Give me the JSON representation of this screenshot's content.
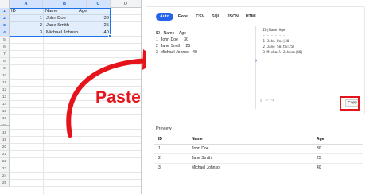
{
  "spreadsheet": {
    "columns": [
      "A",
      "B",
      "C",
      "D"
    ],
    "selected_columns": [
      "A",
      "B",
      "C"
    ],
    "row_numbers": [
      "1",
      "2",
      "3",
      "4",
      "5",
      "6",
      "7",
      "8",
      "9",
      "10",
      "11",
      "12",
      "13",
      "14",
      "15",
      "16",
      "17",
      "18",
      "19",
      "20",
      "21",
      "22",
      "23",
      "24",
      "25"
    ],
    "selected_rows": [
      "1",
      "2",
      "3",
      "4"
    ],
    "cells": {
      "a1": "ID",
      "b1": "Name",
      "c1": "Age",
      "a2": "1",
      "b2": "John Doe",
      "c2": "30",
      "a3": "2",
      "b3": "Jane Smith",
      "c3": "25",
      "a4": "3",
      "b4": "Michael Johnso",
      "c4": "40"
    }
  },
  "overlay": {
    "paste_label": "Paste",
    "accent_color": "#e5141b"
  },
  "converter": {
    "tabs": [
      "Auto",
      "Excel",
      "CSV",
      "SQL",
      "JSON",
      "HTML"
    ],
    "active_tab": "Auto",
    "input_lines": [
      "ID   Name    Age",
      "1  John Doe     30",
      "2  Jane Smith    25",
      "3  Michael Johnso   40"
    ],
    "output_lines": [
      "|ID|Name|Age|",
      "|---|---|---|",
      "|1|John Doe|30|",
      "|2|Jane Smith|25|",
      "|3|Michael Johnso|40|"
    ],
    "copy_label": "Copy",
    "tool_icons": [
      "format-icon",
      "undo-icon",
      "redo-icon"
    ]
  },
  "preview": {
    "title": "Preview",
    "headers": [
      "ID",
      "Name",
      "Age"
    ],
    "rows": [
      [
        "1",
        "John Doe",
        "30"
      ],
      [
        "2",
        "Jane Smith",
        "25"
      ],
      [
        "3",
        "Michael Johnso",
        "40"
      ]
    ]
  },
  "colors": {
    "tab_active": "#2563eb",
    "selection_border": "#1a73e8",
    "highlight_red": "#e5141b"
  }
}
